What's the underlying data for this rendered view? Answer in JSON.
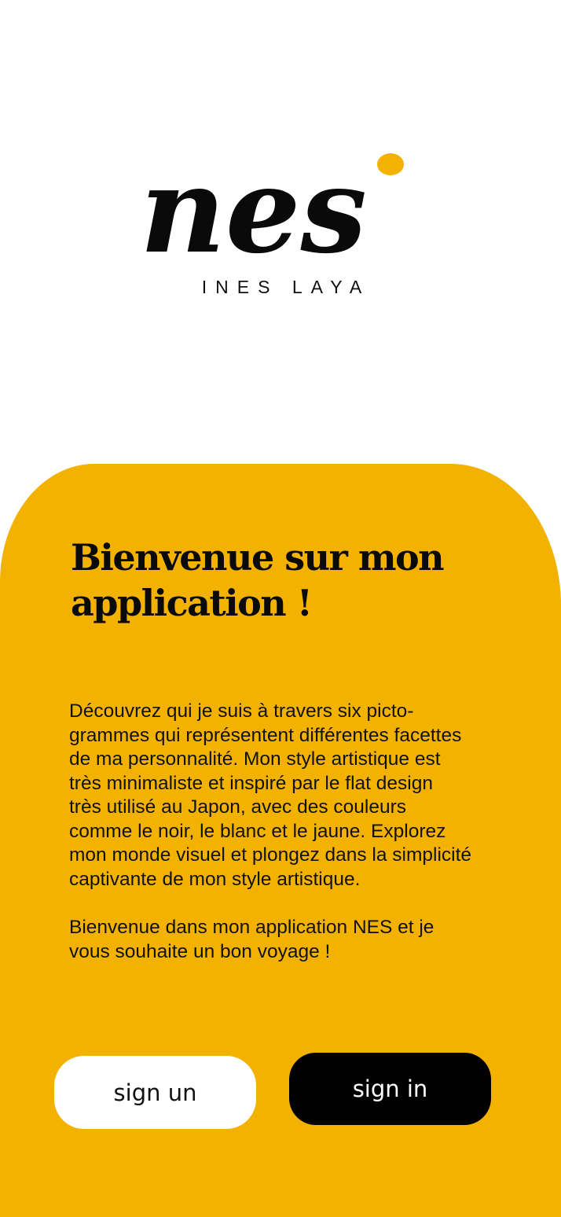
{
  "logo": {
    "wordmark": "nes",
    "dot_color": "#f3b200",
    "ink_color": "#0a0a0a"
  },
  "brand": {
    "name": "INES LAYA"
  },
  "welcome": {
    "title": "Bienvenue sur mon application !",
    "intro": "Découvrez qui je suis à travers six picto-\ngrammes qui représentent différentes facettes\nde ma personnalité. Mon style artistique est\ntrès minimaliste et inspiré par le flat design\ntrès utilisé au Japon, avec des couleurs\ncomme le noir, le blanc et le jaune. Explorez\nmon monde visuel et plongez dans la simplicité\ncaptivante de mon style artistique.",
    "outro": "Bienvenue dans mon application NES et je\nvous souhaite un bon voyage !"
  },
  "actions": {
    "signup_label": "sign un",
    "signin_label": "sign in"
  },
  "colors": {
    "accent": "#f3b200",
    "background": "#ffffff",
    "dark": "#000000"
  }
}
